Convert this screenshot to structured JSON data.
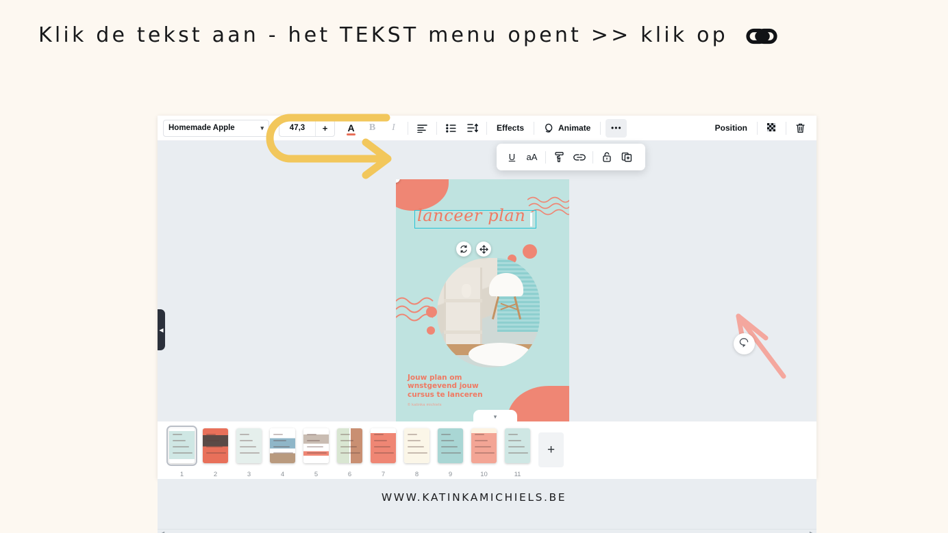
{
  "instruction": {
    "title": "Klik de tekst aan - het TEKST menu opent >> klik op",
    "trailing_icon": "chain-link-icon"
  },
  "footer": {
    "url": "WWW.KATINKAMICHIELS.BE"
  },
  "colors": {
    "page_background": "#fdf8f1",
    "editor_background": "#e9edf1",
    "canvas_mint": "#bfe3e0",
    "canvas_coral": "#ef8674",
    "selection_cyan": "#27c3d6",
    "annotation_yellow": "#f2c75c",
    "annotation_pink": "#f6a297",
    "text_color_swatch": "#e8705a"
  },
  "toolbar": {
    "font_name": "Homemade Apple",
    "font_dropdown_icon": "chevron-down-icon",
    "font_size": "47,3",
    "font_size_increase": "+",
    "text_color_label": "A",
    "bold_label": "B",
    "italic_label": "I",
    "align_icon": "text-align-left-icon",
    "list_icon": "bullet-list-icon",
    "spacing_icon": "line-spacing-icon",
    "effects_label": "Effects",
    "animate_label": "Animate",
    "animate_icon": "animate-icon",
    "more_label": "•••",
    "position_label": "Position",
    "transparency_icon": "transparency-icon",
    "delete_icon": "trash-icon"
  },
  "popup_menu": {
    "items": [
      {
        "label": "U",
        "name": "underline-button"
      },
      {
        "label": "aA",
        "name": "text-case-button"
      },
      {
        "label": "",
        "name": "copy-style-icon"
      },
      {
        "label": "",
        "name": "link-icon"
      },
      {
        "label": "",
        "name": "lock-icon"
      },
      {
        "label": "",
        "name": "duplicate-icon"
      }
    ]
  },
  "canvas": {
    "selected_text": "lanceer plan",
    "body_heading": "Jouw plan om wnstgevend jouw cursus te lanceren",
    "credit": "© katinka michiels",
    "rotate_icon": "rotate-icon",
    "move_icon": "move-icon",
    "comment_icon": "comment-icon"
  },
  "editor_chrome": {
    "collapse_left_icon": "chevron-left-icon",
    "collapse_pages_icon": "chevron-down-icon",
    "scroll_left_icon": "triangle-left-icon",
    "scroll_right_icon": "triangle-right-icon"
  },
  "pages": {
    "add_page_label": "+",
    "items": [
      {
        "num": "1",
        "selected": true,
        "theme": "mint-cover"
      },
      {
        "num": "2",
        "selected": false,
        "theme": "coral-photo"
      },
      {
        "num": "3",
        "selected": false,
        "theme": "mint-cards"
      },
      {
        "num": "4",
        "selected": false,
        "theme": "white-photos"
      },
      {
        "num": "5",
        "selected": false,
        "theme": "white-collage"
      },
      {
        "num": "6",
        "selected": false,
        "theme": "split-photo"
      },
      {
        "num": "7",
        "selected": false,
        "theme": "coral-table"
      },
      {
        "num": "8",
        "selected": false,
        "theme": "cream-diagram"
      },
      {
        "num": "9",
        "selected": false,
        "theme": "mint-dots"
      },
      {
        "num": "10",
        "selected": false,
        "theme": "coral-grid"
      },
      {
        "num": "11",
        "selected": false,
        "theme": "mint-product"
      }
    ]
  }
}
